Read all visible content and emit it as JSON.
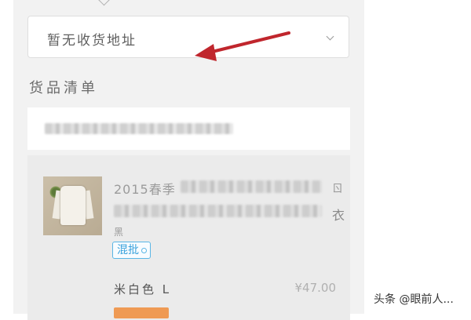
{
  "address": {
    "placeholder_text": "暂无收货地址",
    "chevron_icon": "chevron-down-icon"
  },
  "goods": {
    "section_title": "货品清单",
    "item": {
      "title_visible_start": "2015春季",
      "title_visible_end_line1": "ㄖ",
      "title_visible_end_line2": "衣",
      "spec_line_start": "黑",
      "tag_label": "混批",
      "spec": "米白色 L",
      "price": "¥47.00"
    }
  },
  "watermark": {
    "text": "头条 @眼前人..."
  },
  "colors": {
    "arrow": "#c0262d",
    "tag_blue": "#3aa2dc",
    "accent_orange": "#f08c3a",
    "panel_bg": "#f2f2f2"
  }
}
